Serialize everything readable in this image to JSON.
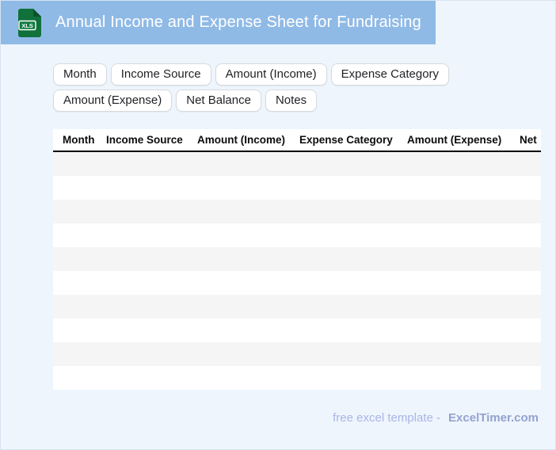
{
  "header": {
    "title": "Annual Income and Expense Sheet for Fundraising",
    "file_icon_label": "XLS"
  },
  "chips": [
    "Month",
    "Income Source",
    "Amount (Income)",
    "Expense Category",
    "Amount (Expense)",
    "Net Balance",
    "Notes"
  ],
  "table": {
    "columns": [
      "Month",
      "Income Source",
      "Amount (Income)",
      "Expense Category",
      "Amount (Expense)",
      "Net"
    ],
    "row_count": 10
  },
  "footer": {
    "text": "free excel template -",
    "brand": "ExcelTimer.com"
  },
  "colors": {
    "header_bg": "#90bae6",
    "page_bg": "#eef5fc",
    "page_border": "#d7e3f1",
    "row_stripe": "#f5f5f5",
    "row_plain": "#ffffff",
    "table_header_border": "#000000",
    "icon_green": "#10713b",
    "footer_text": "#a9b5e8",
    "footer_brand": "#93a2d0"
  }
}
